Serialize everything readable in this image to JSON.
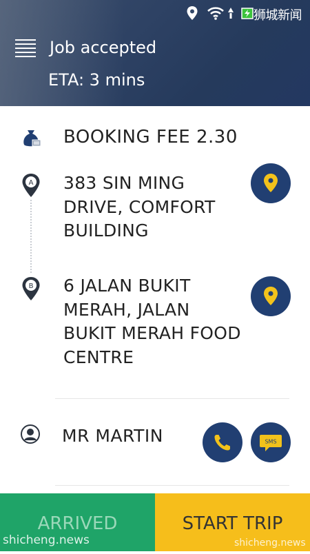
{
  "status_bar": {
    "time_text": "狮城新闻",
    "icons": [
      "location-icon",
      "wifi-icon",
      "signal-icon",
      "battery-charging-icon"
    ]
  },
  "header": {
    "title": "Job accepted",
    "eta": "ETA: 3 mins"
  },
  "booking": {
    "fee_label": "BOOKING FEE  2.30"
  },
  "pickup": {
    "marker": "A",
    "address": "383 SIN MING DRIVE, COMFORT BUILDING"
  },
  "dropoff": {
    "marker": "B",
    "address": "6 JALAN BUKIT MERAH, JALAN BUKIT MERAH FOOD CENTRE"
  },
  "passenger": {
    "name": "MR MARTIN",
    "sms_label": "SMS"
  },
  "footer": {
    "arrived_label": "ARRIVED",
    "start_label": "START TRIP"
  },
  "watermark": {
    "left": "shicheng.news",
    "right": "shicheng.news"
  },
  "colors": {
    "navy": "#213f72",
    "green": "#1fa468",
    "yellow": "#f6be1b"
  }
}
